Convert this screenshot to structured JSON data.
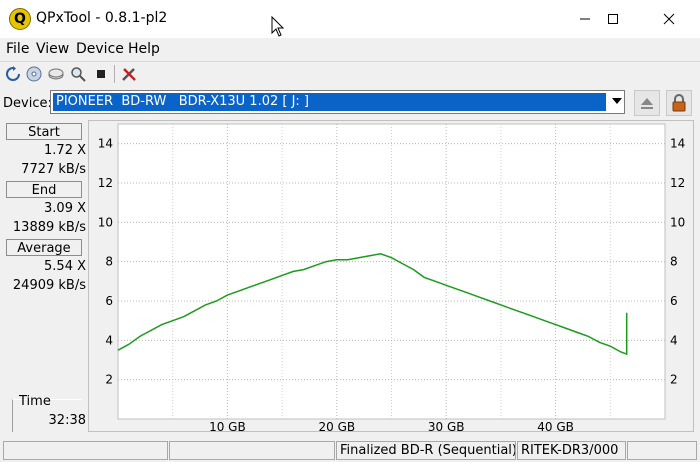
{
  "window": {
    "title": "QPxTool - 0.8.1-pl2",
    "icon_letter": "Q"
  },
  "menu": [
    "File",
    "View",
    "Device",
    "Help"
  ],
  "toolbar": {
    "icons": [
      "refresh-icon",
      "disc-scan-icon",
      "disc-erase-icon",
      "zoom-icon",
      "stop-icon",
      "settings-icon"
    ]
  },
  "device": {
    "label": "Device:",
    "value": "PIONEER  BD-RW   BDR-X13U 1.02 [ J: ]"
  },
  "stats": {
    "start": {
      "label": "Start",
      "speed_x": "1.72 X",
      "speed_kbs": "7727 kB/s"
    },
    "end": {
      "label": "End",
      "speed_x": "3.09 X",
      "speed_kbs": "13889 kB/s"
    },
    "average": {
      "label": "Average",
      "speed_x": "5.54 X",
      "speed_kbs": "24909 kB/s"
    },
    "time": {
      "label": "Time",
      "value": "32:38"
    }
  },
  "chart_data": {
    "type": "line",
    "x_unit": "GB",
    "xlim": [
      0,
      50
    ],
    "ylim": [
      0,
      15
    ],
    "x_ticks": [
      10,
      20,
      30,
      40
    ],
    "x_tick_labels": [
      "10 GB",
      "20 GB",
      "30 GB",
      "40 GB"
    ],
    "y_ticks": [
      2,
      4,
      6,
      8,
      10,
      12,
      14
    ],
    "y_tick_labels": [
      "2",
      "4",
      "6",
      "8",
      "10",
      "12",
      "14"
    ],
    "grid": true,
    "series": [
      {
        "color": "#1c9b1c",
        "x": [
          0,
          1,
          2,
          3,
          4,
          5,
          6,
          7,
          8,
          9,
          10,
          11,
          12,
          13,
          14,
          15,
          16,
          17,
          18,
          19,
          20,
          21,
          22,
          23,
          24,
          25,
          26,
          27,
          28,
          29,
          30,
          31,
          32,
          33,
          34,
          35,
          36,
          37,
          38,
          39,
          40,
          41,
          42,
          43,
          44,
          45,
          46,
          46.5,
          46.5
        ],
        "y": [
          3.5,
          3.8,
          4.2,
          4.5,
          4.8,
          5.0,
          5.2,
          5.5,
          5.8,
          6.0,
          6.3,
          6.5,
          6.7,
          6.9,
          7.1,
          7.3,
          7.5,
          7.6,
          7.8,
          8.0,
          8.1,
          8.1,
          8.2,
          8.3,
          8.4,
          8.2,
          7.9,
          7.6,
          7.2,
          7.0,
          6.8,
          6.6,
          6.4,
          6.2,
          6.0,
          5.8,
          5.6,
          5.4,
          5.2,
          5.0,
          4.8,
          4.6,
          4.4,
          4.2,
          3.9,
          3.7,
          3.4,
          3.3,
          5.4
        ]
      }
    ]
  },
  "statusbar": {
    "cells": [
      "",
      "",
      "Finalized BD-R (Sequential)",
      "RITEK-DR3/000",
      ""
    ]
  }
}
